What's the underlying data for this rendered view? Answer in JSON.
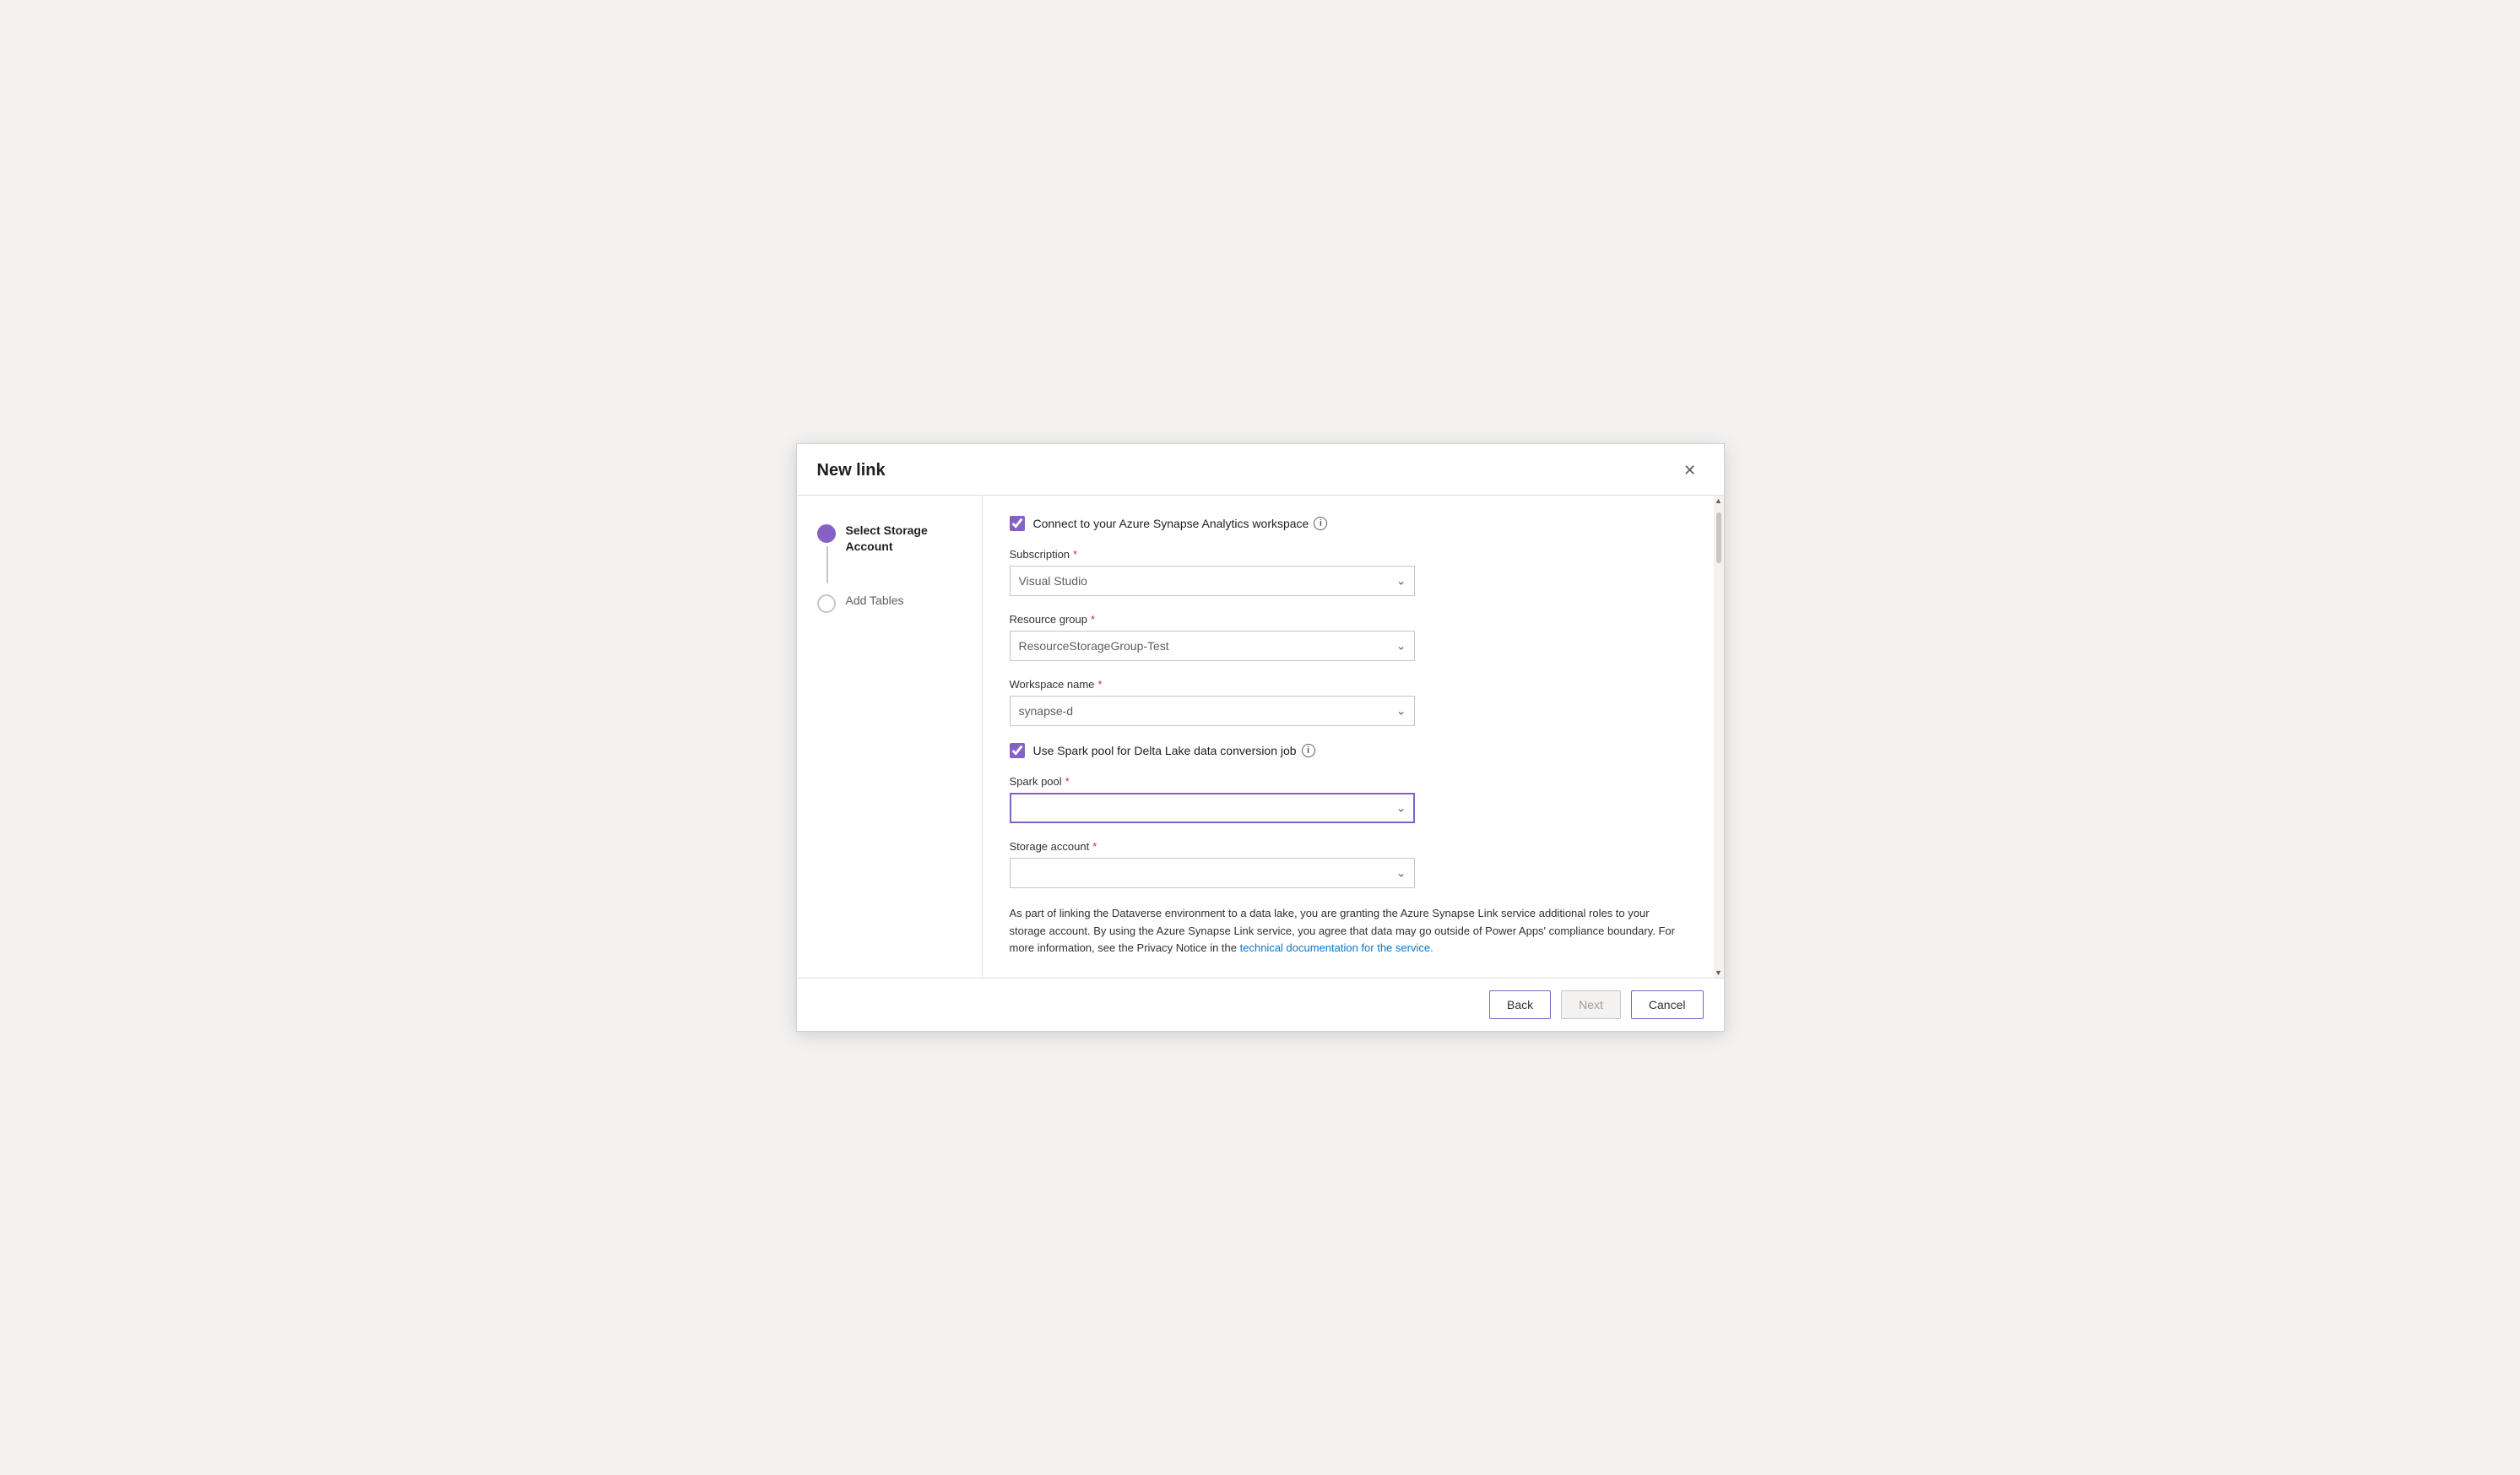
{
  "dialog": {
    "title": "New link",
    "close_label": "×"
  },
  "stepper": {
    "steps": [
      {
        "id": "select-storage",
        "label": "Select Storage Account",
        "state": "active"
      },
      {
        "id": "add-tables",
        "label": "Add Tables",
        "state": "inactive"
      }
    ]
  },
  "form": {
    "connect_checkbox_label": "Connect to your Azure Synapse Analytics workspace",
    "connect_checked": true,
    "subscription": {
      "label": "Subscription",
      "required": true,
      "value": "Visual Studio",
      "placeholder": "Visual Studio..."
    },
    "resource_group": {
      "label": "Resource group",
      "required": true,
      "value": "ResourceStorageGroup-Test",
      "placeholder": "ResourceStorageGroup-Test"
    },
    "workspace_name": {
      "label": "Workspace name",
      "required": true,
      "value": "synapse-d",
      "placeholder": "synapse-d"
    },
    "spark_pool_checkbox_label": "Use Spark pool for Delta Lake data conversion job",
    "spark_pool_checked": true,
    "spark_pool": {
      "label": "Spark pool",
      "required": true,
      "value": "",
      "placeholder": ""
    },
    "storage_account": {
      "label": "Storage account",
      "required": true,
      "value": "",
      "placeholder": ""
    },
    "info_text": "As part of linking the Dataverse environment to a data lake, you are granting the Azure Synapse Link service additional roles to your storage account. By using the Azure Synapse Link service, you agree that data may go outside of Power Apps' compliance boundary. For more information, see the Privacy Notice in the ",
    "info_link_text": "technical documentation for the service.",
    "info_link_href": "#"
  },
  "footer": {
    "back_label": "Back",
    "next_label": "Next",
    "cancel_label": "Cancel"
  },
  "icons": {
    "info": "ⓘ",
    "chevron_down": "⌄",
    "close": "✕"
  }
}
